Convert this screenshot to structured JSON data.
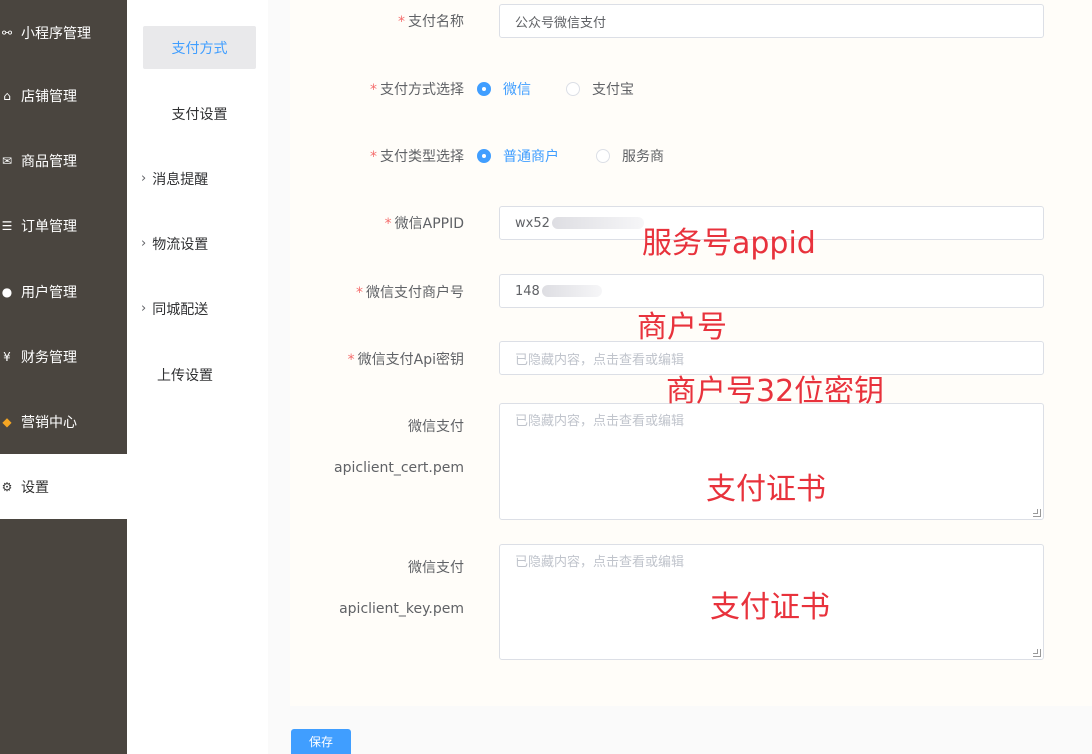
{
  "sidebar": {
    "items": [
      {
        "icon": "mini-program-icon",
        "glyph": "⚯",
        "label": "小程序管理"
      },
      {
        "icon": "store-icon",
        "glyph": "⌂",
        "label": "店铺管理"
      },
      {
        "icon": "goods-icon",
        "glyph": "✉",
        "label": "商品管理"
      },
      {
        "icon": "order-icon",
        "glyph": "☰",
        "label": "订单管理"
      },
      {
        "icon": "user-icon",
        "glyph": "●",
        "label": "用户管理"
      },
      {
        "icon": "finance-icon",
        "glyph": "¥",
        "label": "财务管理"
      },
      {
        "icon": "marketing-icon",
        "glyph": "◆",
        "label": "营销中心"
      },
      {
        "icon": "settings-icon",
        "glyph": "⚙",
        "label": "设置"
      }
    ],
    "active": "设置"
  },
  "submenu": {
    "items": [
      {
        "label": "支付方式",
        "expandable": false
      },
      {
        "label": "支付设置",
        "expandable": false
      },
      {
        "label": "消息提醒",
        "expandable": true
      },
      {
        "label": "物流设置",
        "expandable": true
      },
      {
        "label": "同城配送",
        "expandable": true
      },
      {
        "label": "上传设置",
        "expandable": false
      }
    ],
    "active": "支付方式"
  },
  "form": {
    "pay_name": {
      "label": "支付名称",
      "value": "公众号微信支付"
    },
    "pay_method": {
      "label": "支付方式选择",
      "options": [
        "微信",
        "支付宝"
      ],
      "selected": "微信"
    },
    "pay_type": {
      "label": "支付类型选择",
      "options": [
        "普通商户",
        "服务商"
      ],
      "selected": "普通商户"
    },
    "appid": {
      "label": "微信APPID",
      "value": "wx52"
    },
    "mch_id": {
      "label": "微信支付商户号",
      "value": "148"
    },
    "api_key": {
      "label": "微信支付Api密钥",
      "placeholder": "已隐藏内容，点击查看或编辑"
    },
    "cert": {
      "label_line1": "微信支付",
      "label_line2": "apiclient_cert.pem",
      "placeholder": "已隐藏内容，点击查看或编辑"
    },
    "key": {
      "label_line1": "微信支付",
      "label_line2": "apiclient_key.pem",
      "placeholder": "已隐藏内容，点击查看或编辑"
    },
    "save_label": "保存"
  },
  "annotations": {
    "appid_note": "服务号appid",
    "mch_note": "商户号",
    "key_note": "商户号32位密钥",
    "cert_note": "支付证书",
    "keyfile_note": "支付证书"
  },
  "colors": {
    "sidebar_bg": "#4a453f",
    "accent": "#409eff",
    "required": "#f56c6c",
    "annotation": "#e8323c"
  }
}
